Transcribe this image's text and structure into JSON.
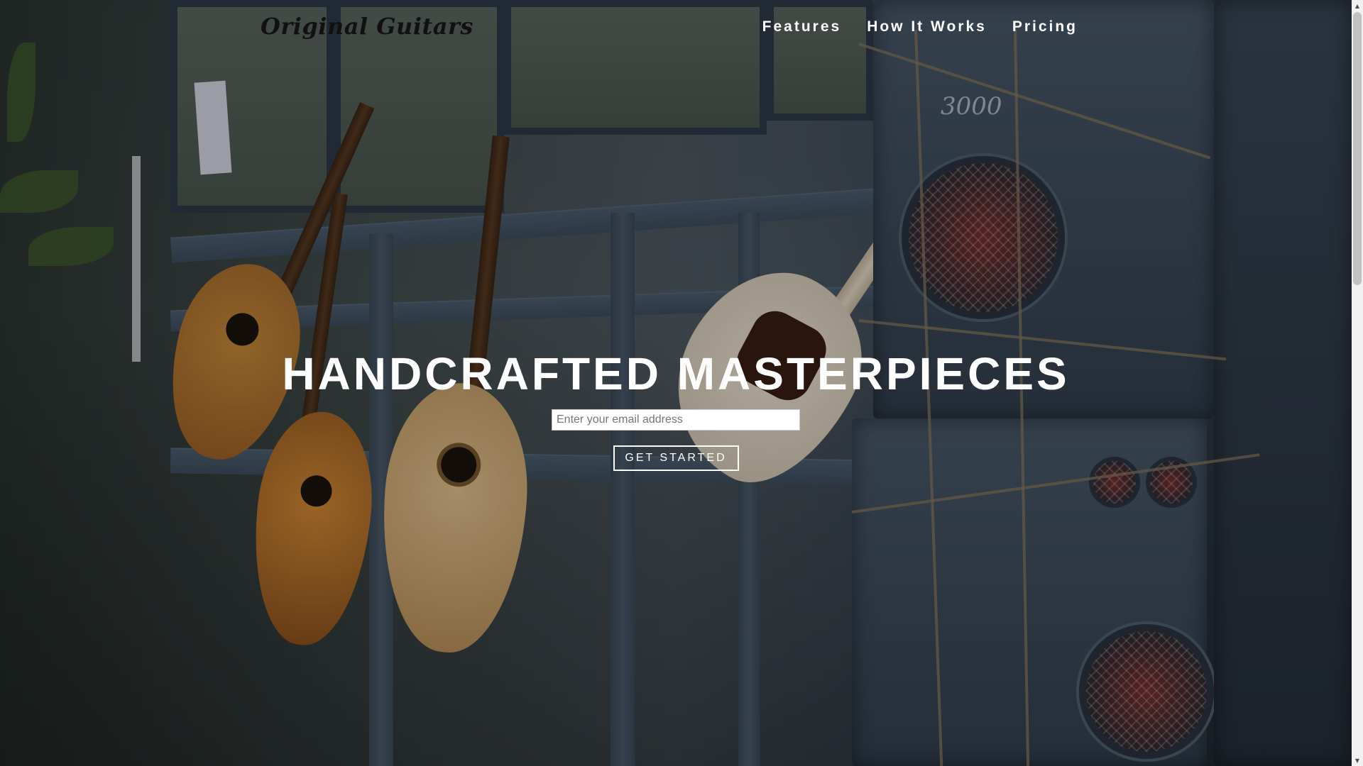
{
  "header": {
    "logo": "Original Guitars",
    "nav": [
      {
        "label": "Features"
      },
      {
        "label": "How It Works"
      },
      {
        "label": "Pricing"
      }
    ]
  },
  "hero": {
    "title": "HANDCRAFTED MASTERPIECES",
    "email_placeholder": "Enter your email address",
    "cta_label": "GET STARTED"
  },
  "scrollbar": {
    "up_icon": "triangle-up-icon",
    "down_icon": "triangle-down-icon"
  },
  "colors": {
    "logo": "#111111",
    "nav_text": "#ffffff",
    "hero_text": "#ffffff",
    "input_bg": "#ffffff",
    "button_border": "#ffffff"
  }
}
